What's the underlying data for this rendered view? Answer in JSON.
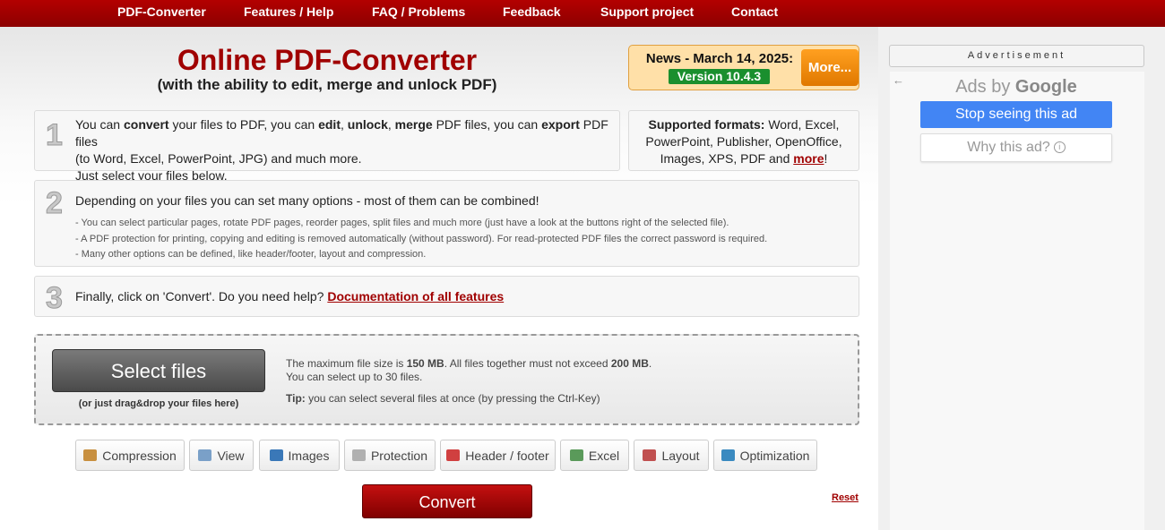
{
  "nav": {
    "items": [
      "PDF-Converter",
      "Features / Help",
      "FAQ / Problems",
      "Feedback",
      "Support project",
      "Contact"
    ]
  },
  "header": {
    "title": "Online PDF-Converter",
    "subtitle": "(with the ability to edit, merge and unlock PDF)"
  },
  "news": {
    "title": "News - March 14, 2025:",
    "version": "Version 10.4.3",
    "more": "More..."
  },
  "step1": {
    "number": "1",
    "t1": "You can ",
    "b1": "convert",
    "t2": " your files to PDF, you can ",
    "b2": "edit",
    "t3": ", ",
    "b3": "unlock",
    "t4": ", ",
    "b4": "merge",
    "t5": " PDF files, you can ",
    "b5": "export",
    "t6": " PDF files",
    "line2": "(to Word, Excel, PowerPoint, JPG) and much more.",
    "line3": "Just select your files below."
  },
  "formats": {
    "label": "Supported formats:",
    "list": " Word, Excel, PowerPoint, Publisher, OpenOffice, Images, XPS, PDF and ",
    "more": "more",
    "end": "!"
  },
  "step2": {
    "number": "2",
    "head": "Depending on your files you can set many options - most of them can be combined!",
    "lines": [
      "- You can select particular pages, rotate PDF pages, reorder pages, split files and much more (just have a look at the buttons right of the selected file).",
      "- A PDF protection for printing, copying and editing is removed automatically (without password). For read-protected PDF files the correct password is required.",
      "- Many other options can be defined, like header/footer, layout and compression."
    ]
  },
  "step3": {
    "number": "3",
    "text": "Finally, click on 'Convert'. Do you need help? ",
    "link": "Documentation of all features"
  },
  "upload": {
    "button": "Select files",
    "hint": "(or just drag&drop your files here)",
    "max_a": "The maximum file size is ",
    "max_b": "150 MB",
    "max_c": ". All files together must not exceed ",
    "max_d": "200 MB",
    "max_e": ".",
    "count": "You can select up to 30 files.",
    "tip_label": "Tip:",
    "tip_text": " you can select several files at once (by pressing the Ctrl-Key)"
  },
  "options": [
    {
      "label": "Compression",
      "icon": "compression-icon",
      "color": "#c89040"
    },
    {
      "label": "View",
      "icon": "view-icon",
      "color": "#7aa0c8"
    },
    {
      "label": "Images",
      "icon": "images-icon",
      "color": "#3a78b8"
    },
    {
      "label": "Protection",
      "icon": "lock-icon",
      "color": "#b0b0b0"
    },
    {
      "label": "Header / footer",
      "icon": "header-footer-icon",
      "color": "#d04040"
    },
    {
      "label": "Excel",
      "icon": "excel-icon",
      "color": "#5a9a5a"
    },
    {
      "label": "Layout",
      "icon": "layout-icon",
      "color": "#c05050"
    },
    {
      "label": "Optimization",
      "icon": "optimization-icon",
      "color": "#3a8ac0"
    }
  ],
  "actions": {
    "convert": "Convert",
    "reset": "Reset"
  },
  "ad": {
    "label": "Advertisement",
    "back": "←",
    "ads_by": "Ads by ",
    "google": "Google",
    "stop": "Stop seeing this ad",
    "why": "Why this ad?",
    "info": "i"
  }
}
